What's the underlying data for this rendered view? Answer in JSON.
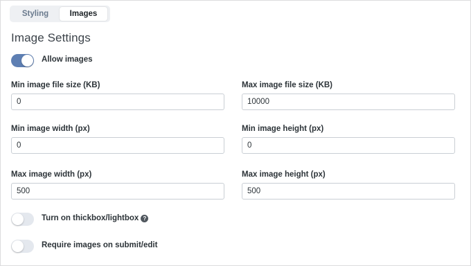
{
  "tabs": [
    {
      "label": "Styling",
      "active": false
    },
    {
      "label": "Images",
      "active": true
    }
  ],
  "section_title": "Image Settings",
  "toggles": {
    "allow_images": {
      "label": "Allow images",
      "on": true
    },
    "thickbox": {
      "label": "Turn on thickbox/lightbox",
      "on": false,
      "help_icon": "question-circle-icon"
    },
    "require_images": {
      "label": "Require images on submit/edit",
      "on": false
    }
  },
  "fields": {
    "min_file_size": {
      "label": "Min image file size (KB)",
      "value": "0"
    },
    "max_file_size": {
      "label": "Max image file size (KB)",
      "value": "10000"
    },
    "min_width": {
      "label": "Min image width (px)",
      "value": "0"
    },
    "min_height": {
      "label": "Min image height (px)",
      "value": "0"
    },
    "max_width": {
      "label": "Max image width (px)",
      "value": "500"
    },
    "max_height": {
      "label": "Max image height (px)",
      "value": "500"
    }
  },
  "colors": {
    "toggle_on": "#5e7fb3",
    "toggle_off": "#e4e8ee"
  }
}
